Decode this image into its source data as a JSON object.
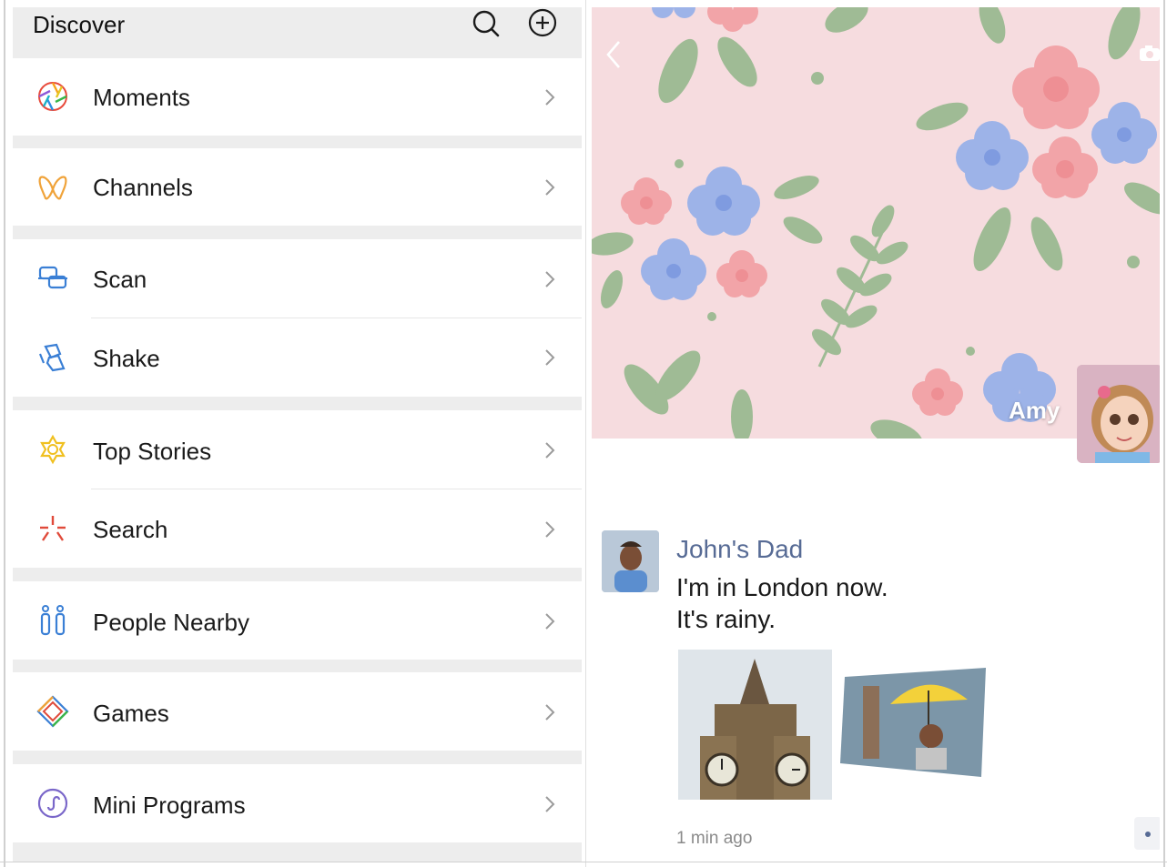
{
  "header": {
    "title": "Discover",
    "search_icon": "search-icon",
    "add_icon": "plus-circle-icon"
  },
  "menu": {
    "items": [
      {
        "label": "Moments",
        "icon": "moments-aperture-icon"
      },
      {
        "label": "Channels",
        "icon": "channels-butterfly-icon"
      },
      {
        "label": "Scan",
        "icon": "scan-icon"
      },
      {
        "label": "Shake",
        "icon": "shake-icon"
      },
      {
        "label": "Top Stories",
        "icon": "top-stories-icon"
      },
      {
        "label": "Search",
        "icon": "search-sparkle-icon"
      },
      {
        "label": "People Nearby",
        "icon": "people-nearby-icon"
      },
      {
        "label": "Games",
        "icon": "games-icon"
      },
      {
        "label": "Mini Programs",
        "icon": "mini-programs-icon"
      }
    ]
  },
  "moments": {
    "owner_name": "Amy",
    "post": {
      "author": "John's Dad",
      "text_line1": "I'm in London now.",
      "text_line2": "It's rainy.",
      "time": "1 min ago"
    }
  },
  "colors": {
    "link_blue": "#576b95",
    "group_bg": "#ededed",
    "cover_bg": "#f6dcdf"
  }
}
